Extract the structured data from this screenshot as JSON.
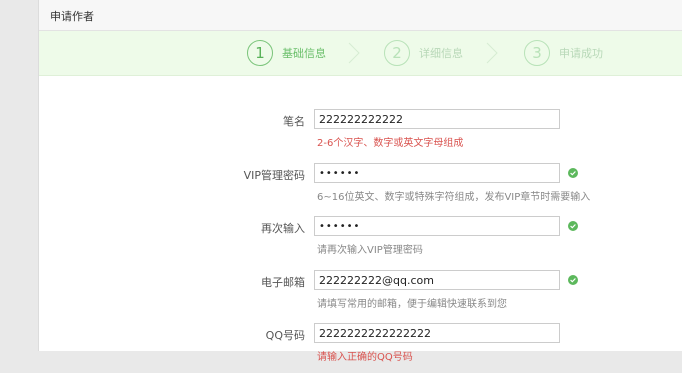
{
  "header": {
    "title": "申请作者"
  },
  "steps": [
    {
      "number": "1",
      "label": "基础信息",
      "active": true
    },
    {
      "number": "2",
      "label": "详细信息",
      "active": false
    },
    {
      "number": "3",
      "label": "申请成功",
      "active": false
    }
  ],
  "form": {
    "pen_name": {
      "label": "笔名",
      "value": "222222222222",
      "hint": "2-6个汉字、数字或英文字母组成",
      "hint_type": "error"
    },
    "vip_password": {
      "label": "VIP管理密码",
      "value": "••••••",
      "hint": "6~16位英文、数字或特殊字符组成，发布VIP章节时需要输入",
      "valid": true
    },
    "confirm_password": {
      "label": "再次输入",
      "value": "••••••",
      "hint": "请再次输入VIP管理密码",
      "valid": true
    },
    "email": {
      "label": "电子邮箱",
      "value": "222222222@qq.com",
      "hint": "请填写常用的邮箱，便于编辑快速联系到您",
      "valid": true
    },
    "qq": {
      "label": "QQ号码",
      "value": "2222222222222222",
      "hint": "请输入正确的QQ号码",
      "hint_type": "error"
    }
  },
  "colors": {
    "accent_green": "#5cb85c",
    "error_red": "#d9534f",
    "steps_background": "#eefbe9"
  },
  "icons": {
    "valid": "check-circle-icon",
    "step_separator": "chevron-right-icon"
  }
}
